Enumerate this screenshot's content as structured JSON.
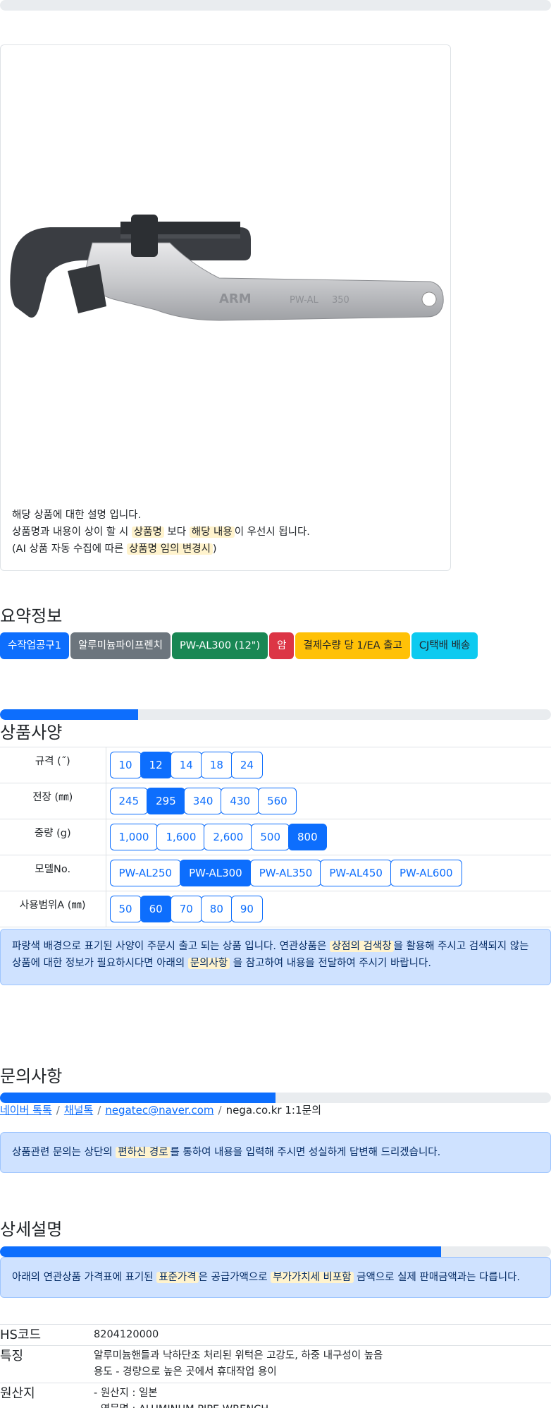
{
  "product_image_alt": "ARM PW-AL 350mm aluminum pipe wrench",
  "card": {
    "line1": "해당 상품에 대한 설명 입니다.",
    "line2_a": "상품명과 내용이 상이 할 시 ",
    "line2_h1": "상품명",
    "line2_b": " 보다 ",
    "line2_h2": "해당 내용",
    "line2_c": "이 우선시 됩니다.",
    "line3_a": "(AI 상품 자동 수집에 따른 ",
    "line3_h": "상품명 임의 변경시",
    "line3_b": ")"
  },
  "summary": {
    "title": "요약정보",
    "badges": [
      "수작업공구1",
      "알루미늄파이프렌치",
      "PW-AL300 (12\")",
      "암",
      "결제수량 당 1/EA 출고",
      "CJ택배 배송"
    ],
    "badge_colors": [
      "#0d6efd",
      "#6c757d",
      "#198754",
      "#dc3545",
      "#ffc107",
      "#0dcaf0"
    ]
  },
  "spec": {
    "title": "상품사양",
    "progress": 0.25,
    "rows": [
      {
        "label": "규격 (˝)",
        "options": [
          "10",
          "12",
          "14",
          "18",
          "24"
        ],
        "selected": "12"
      },
      {
        "label": "전장 (㎜)",
        "options": [
          "245",
          "295",
          "340",
          "430",
          "560"
        ],
        "selected": "295"
      },
      {
        "label": "중량 (g)",
        "options": [
          "1,000",
          "1,600",
          "2,600",
          "500",
          "800"
        ],
        "selected": "800"
      },
      {
        "label": "모델No.",
        "options": [
          "PW-AL250",
          "PW-AL300",
          "PW-AL350",
          "PW-AL450",
          "PW-AL600"
        ],
        "selected": "PW-AL300"
      },
      {
        "label": "사용범위A (㎜)",
        "options": [
          "50",
          "60",
          "70",
          "80",
          "90"
        ],
        "selected": "60"
      }
    ],
    "notice_a": "파랑색 배경으로 표기된 사양이 주문시 출고 되는 상품 입니다. 연관상품은 ",
    "notice_h1": "상점의 검색창",
    "notice_b": "을 활용해 주시고 검색되지 않는 상품에 대한 정보가 필요하시다면 아래의 ",
    "notice_h2": "문의사항",
    "notice_c": " 을 참고하여 내용을 전달하여 주시기 바랍니다."
  },
  "inquiry": {
    "title": "문의사항",
    "progress": 0.5,
    "link1": "네이버 톡톡",
    "link2": "채널톡",
    "link3": "negatec@naver.com",
    "text4": "nega.co.kr 1:1문의",
    "notice_a": "상품관련 문의는 상단의 ",
    "notice_h": "편하신 경로",
    "notice_b": "를 통하여 내용을 입력해 주시면 성실하게 답변해 드리겠습니다."
  },
  "detail": {
    "title": "상세설명",
    "progress": 0.8,
    "notice_a": "아래의 연관상품 가격표에 표기된 ",
    "notice_h1": "표준가격",
    "notice_b": "은 공급가액으로 ",
    "notice_h2": "부가가치세 비포함",
    "notice_c": " 금액으로 실제 판매금액과는 다릅니다.",
    "rows": [
      {
        "k": "HS코드",
        "v1": "8204120000",
        "v2": ""
      },
      {
        "k": "특징",
        "v1": "알루미늄핸들과 낙하단조 처리된 위턱은 고강도, 하중 내구성이 높음",
        "v2": "용도 - 경량으로 높은 곳에서 휴대작업 용이"
      },
      {
        "k": "원산지",
        "v1": "- 원산지 : 일본",
        "v2": "- 영문명 : ALUMINUM PIPE WRENCH"
      }
    ]
  }
}
